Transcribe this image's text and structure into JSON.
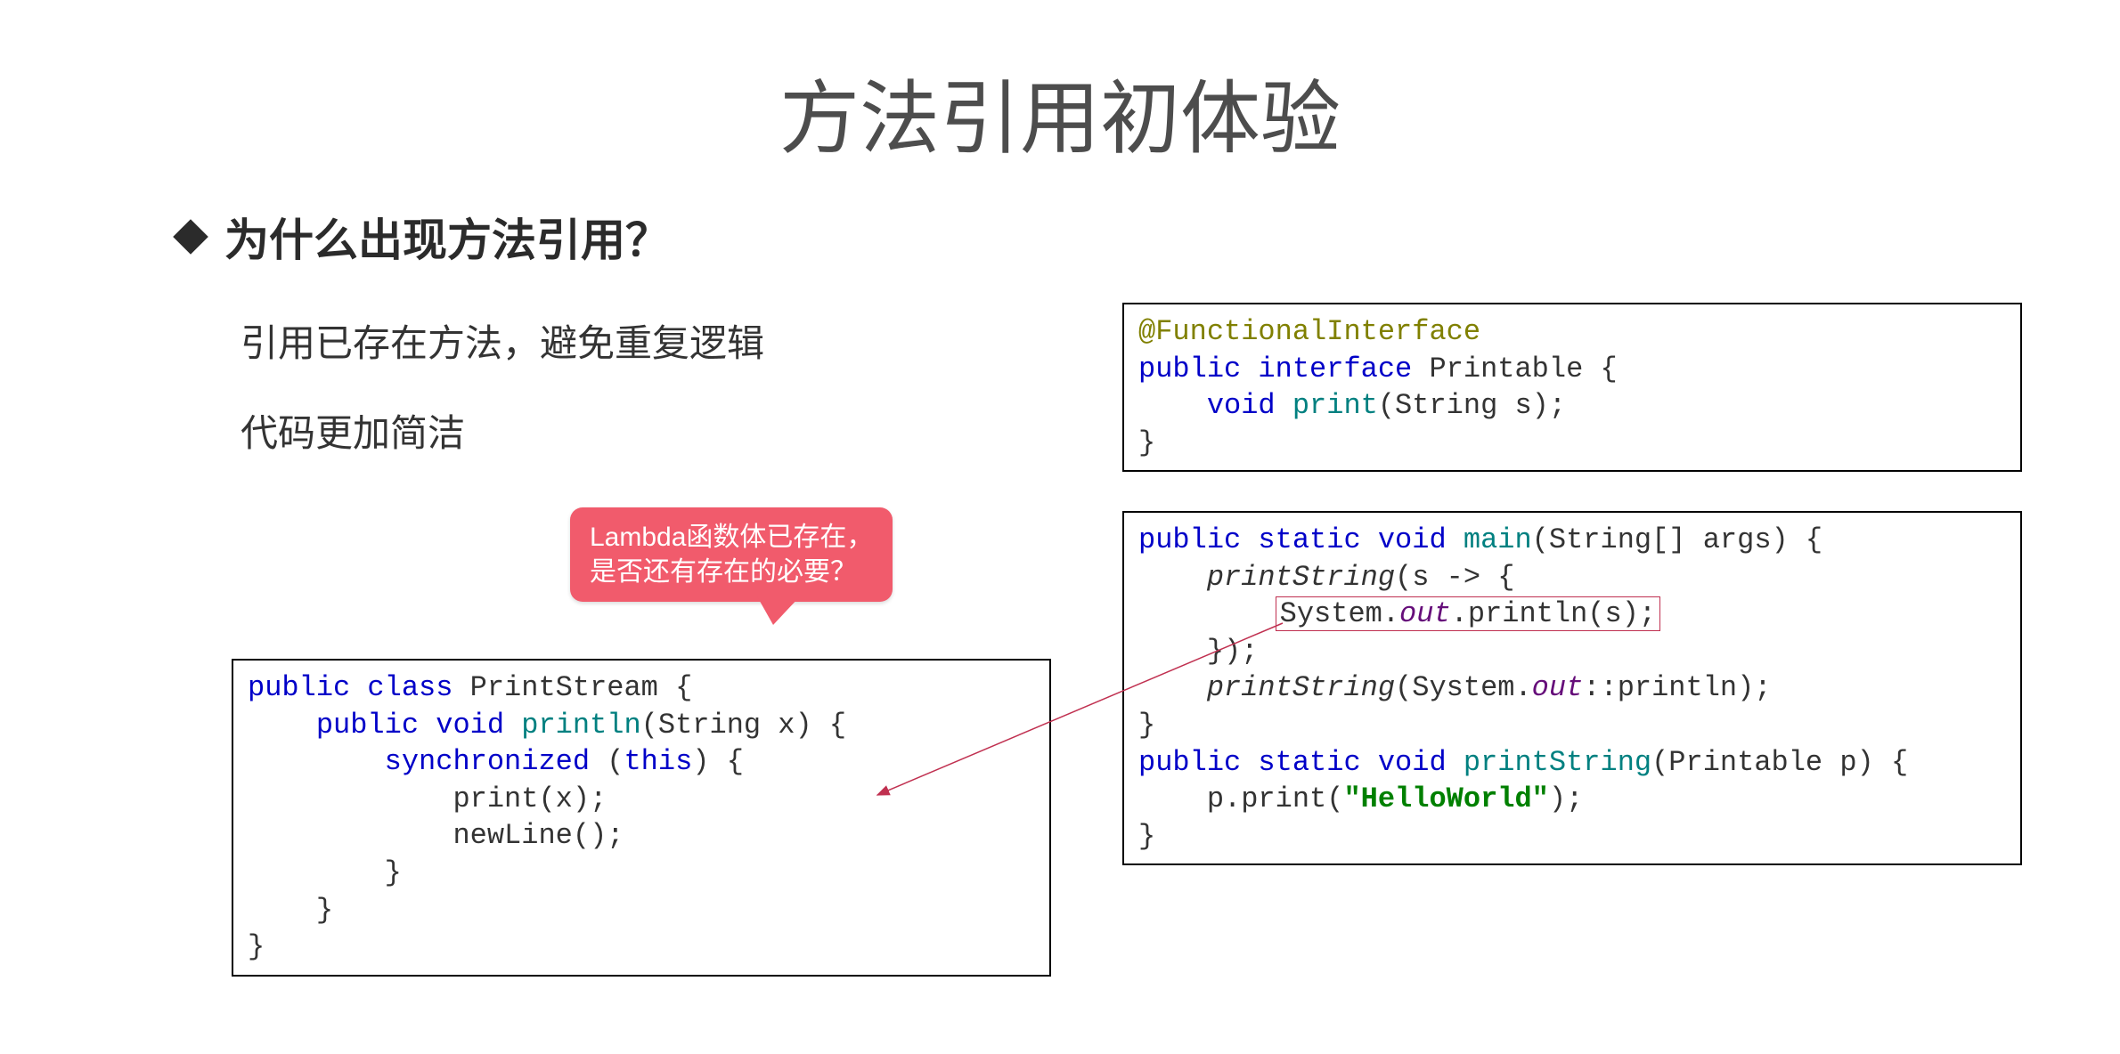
{
  "title": "方法引用初体验",
  "heading": "为什么出现方法引用？",
  "sub1": "引用已存在方法，避免重复逻辑",
  "sub2": "代码更加简洁",
  "callout_line1": "Lambda函数体已存在，",
  "callout_line2": "是否还有存在的必要？",
  "code_left": {
    "l1_public": "public",
    "l1_class": "class",
    "l1_name": "PrintStream {",
    "l2_public": "public",
    "l2_void": "void",
    "l2_method": "println",
    "l2_params": "(String x) {",
    "l3_sync": "synchronized",
    "l3_this": "this",
    "l3_open": "(",
    "l3_close": ") {",
    "l4": "            print(x);",
    "l5": "            newLine();",
    "l6": "        }",
    "l7": "    }",
    "l8": "}"
  },
  "code_top": {
    "anno": "@FunctionalInterface",
    "l2_public": "public",
    "l2_interface": "interface",
    "l2_name": "Printable {",
    "l3_void": "void",
    "l3_method": "print",
    "l3_params": "(String s);",
    "l4": "}"
  },
  "code_bottom": {
    "l1_public": "public",
    "l1_static": "static",
    "l1_void": "void",
    "l1_main": "main",
    "l1_params": "(String[] args) {",
    "l2_call": "printString",
    "l2_arrow": "(s -> {",
    "l3_sys": "System.",
    "l3_out": "out",
    "l3_println": ".println(s);",
    "l4": "    });",
    "l5_call": "printString",
    "l5_sys": "(System.",
    "l5_out": "out",
    "l5_ref": "::println);",
    "l6": "}",
    "l7_public": "public",
    "l7_static": "static",
    "l7_void": "void",
    "l7_method": "printString",
    "l7_params": "(Printable p) {",
    "l8_p": "    p.print(",
    "l8_str": "\"HelloWorld\"",
    "l8_close": ");",
    "l9": "}"
  }
}
